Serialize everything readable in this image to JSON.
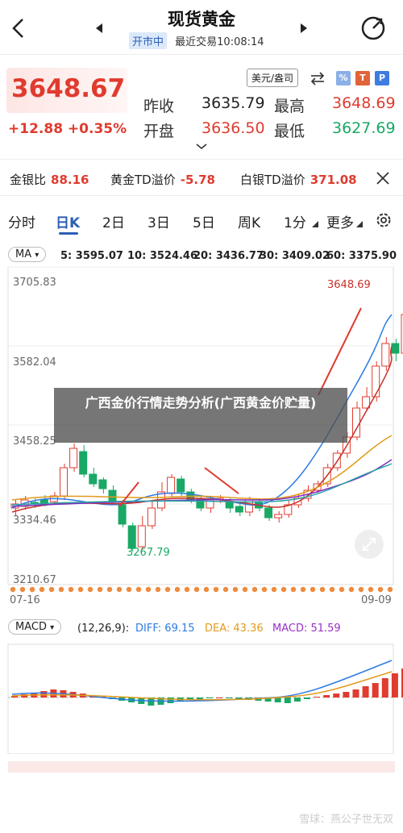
{
  "header": {
    "title": "现货黄金",
    "market_badge": "开市中",
    "last_trade": "最近交易10:08:14"
  },
  "quote": {
    "price": "3648.67",
    "change": "+12.88 +0.35%",
    "prev_close_label": "昨收",
    "prev_close": "3635.79",
    "open_label": "开盘",
    "open": "3636.50",
    "high_label": "最高",
    "high": "3648.69",
    "low_label": "最低",
    "low": "3627.69",
    "unit": "美元/盎司",
    "icon_letters": [
      "%",
      "T",
      "P"
    ]
  },
  "spread_bar": {
    "items": [
      {
        "label": "金银比",
        "value": "88.16"
      },
      {
        "label": "黄金TD溢价",
        "value": "-5.78"
      },
      {
        "label": "白银TD溢价",
        "value": "371.08"
      }
    ]
  },
  "tabs": [
    "分时",
    "日K",
    "2日",
    "3日",
    "5日",
    "周K",
    "1分",
    "更多"
  ],
  "ma_bar": {
    "button": "MA",
    "items": [
      {
        "text": "5: 3595.07",
        "color": "#2d7be3"
      },
      {
        "text": "10: 3524.46",
        "color": "#c8312a"
      },
      {
        "text": "20: 3436.77",
        "color": "#e39a1b"
      },
      {
        "text": "30: 3409.02",
        "color": "#7b2fc4"
      },
      {
        "text": "60: 3375.90",
        "color": "#2aa3a3"
      }
    ]
  },
  "price_chart": {
    "y_labels": [
      "3705.83",
      "3582.04",
      "3458.25",
      "3334.46",
      "3210.67"
    ],
    "x_labels": [
      "07-16",
      "09-09"
    ],
    "high_marker": "3648.69",
    "low_marker": "3267.79"
  },
  "overlay": {
    "text": "广西金价行情走势分析(广西黄金价贮量)"
  },
  "macd_bar": {
    "button": "MACD",
    "params": "(12,26,9):",
    "diff": "DIFF: 69.15",
    "dea": "DEA: 43.36",
    "macd": "MACD: 51.59",
    "colors": {
      "diff": "#2d7be3",
      "dea": "#e39a1b",
      "macd": "#9b2fc4"
    }
  },
  "footer": {
    "watermark": "雪球：燕公子世无双"
  },
  "colors": {
    "up": "#e03b2f",
    "down": "#19a865",
    "accent": "#2d5fb4"
  }
}
